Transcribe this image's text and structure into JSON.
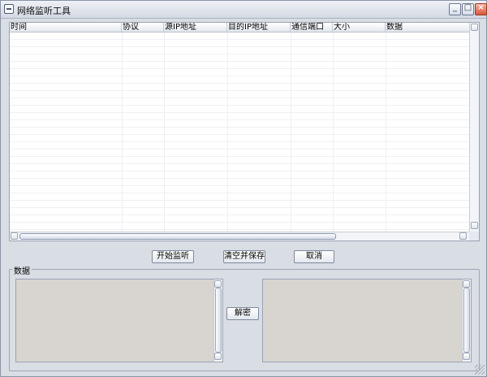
{
  "window": {
    "title": "网络监听工具",
    "icon": "app-icon",
    "controls": [
      "minimize-icon",
      "maximize-icon",
      "close-icon"
    ]
  },
  "table": {
    "columns": [
      "时间",
      "协议",
      "源IP地址",
      "目的IP地址",
      "通信端口",
      "大小",
      "数据"
    ],
    "rows": []
  },
  "actions": {
    "start_label": "开始监听",
    "clear_save_label": "清空并保存",
    "cancel_label": "取消"
  },
  "data_group": {
    "label": "数据",
    "left_text": "",
    "right_text": "",
    "decrypt_label": "解密"
  }
}
